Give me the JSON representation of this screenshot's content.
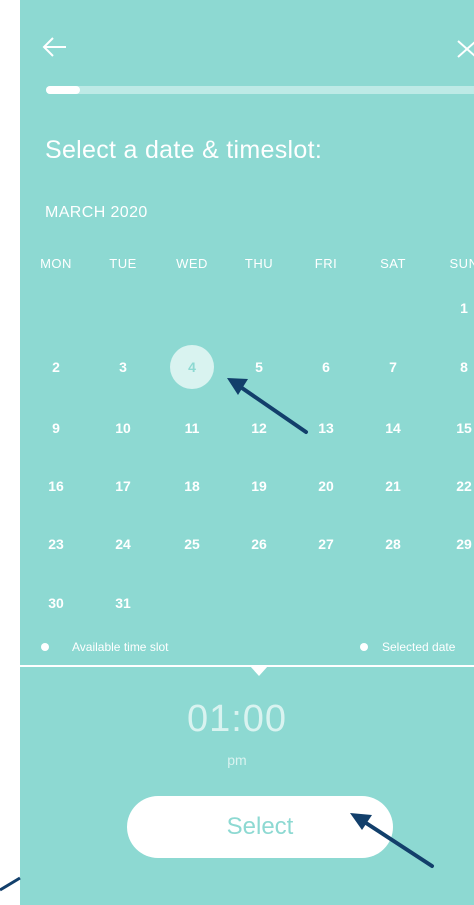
{
  "header": {
    "back_icon": "arrow-left-icon",
    "close_icon": "close-icon",
    "progress_fraction": 0.08
  },
  "page": {
    "title": "Select a date & timeslot:",
    "month": "MARCH 2020"
  },
  "calendar": {
    "weekdays": [
      "MON",
      "TUE",
      "WED",
      "THU",
      "FRI",
      "SAT",
      "SUN"
    ],
    "days": [
      "1",
      "2",
      "3",
      "4",
      "5",
      "6",
      "7",
      "8",
      "9",
      "10",
      "11",
      "12",
      "13",
      "14",
      "15",
      "16",
      "17",
      "18",
      "19",
      "20",
      "21",
      "22",
      "23",
      "24",
      "25",
      "26",
      "27",
      "28",
      "29",
      "30",
      "31"
    ],
    "selected_day": "4"
  },
  "legend": {
    "available_label": "Available time slot",
    "selected_label": "Selected date"
  },
  "time": {
    "value": "01:00",
    "period": "pm"
  },
  "action": {
    "select_label": "Select"
  },
  "colors": {
    "background": "#8dd9d2",
    "text": "#ffffff",
    "annotation_arrow": "#123f6b"
  }
}
